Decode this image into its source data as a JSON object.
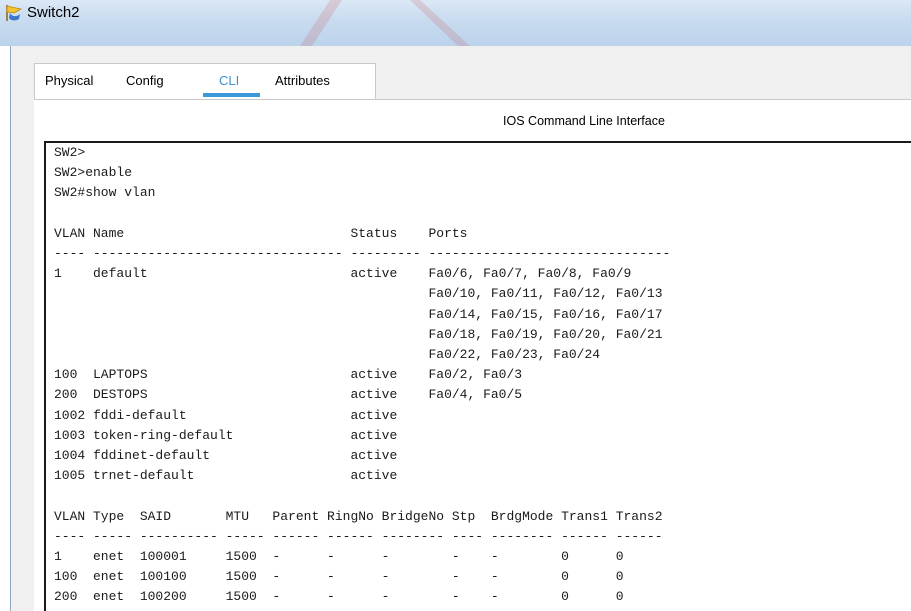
{
  "window": {
    "title": "Switch2"
  },
  "tabs": [
    {
      "label": "Physical",
      "active": false
    },
    {
      "label": "Config",
      "active": false
    },
    {
      "label": "CLI",
      "active": true
    },
    {
      "label": "Attributes",
      "active": false
    }
  ],
  "cli": {
    "heading": "IOS Command Line Interface",
    "lines": [
      "SW2>",
      "SW2>enable",
      "SW2#show vlan",
      "",
      "VLAN Name                             Status    Ports",
      "---- -------------------------------- --------- -------------------------------",
      "1    default                          active    Fa0/6, Fa0/7, Fa0/8, Fa0/9",
      "                                                Fa0/10, Fa0/11, Fa0/12, Fa0/13",
      "                                                Fa0/14, Fa0/15, Fa0/16, Fa0/17",
      "                                                Fa0/18, Fa0/19, Fa0/20, Fa0/21",
      "                                                Fa0/22, Fa0/23, Fa0/24",
      "100  LAPTOPS                          active    Fa0/2, Fa0/3",
      "200  DESTOPS                          active    Fa0/4, Fa0/5",
      "1002 fddi-default                     active",
      "1003 token-ring-default               active",
      "1004 fddinet-default                  active",
      "1005 trnet-default                    active",
      "",
      "VLAN Type  SAID       MTU   Parent RingNo BridgeNo Stp  BrdgMode Trans1 Trans2",
      "---- ----- ---------- ----- ------ ------ -------- ---- -------- ------ ------",
      "1    enet  100001     1500  -      -      -        -    -        0      0",
      "100  enet  100100     1500  -      -      -        -    -        0      0",
      "200  enet  100200     1500  -      -      -        -    -        0      0"
    ]
  },
  "colors": {
    "active_tab": "#3c8fd1",
    "titlebar": "#c8dbef"
  },
  "icons": {
    "app": "cisco-switch-icon"
  }
}
